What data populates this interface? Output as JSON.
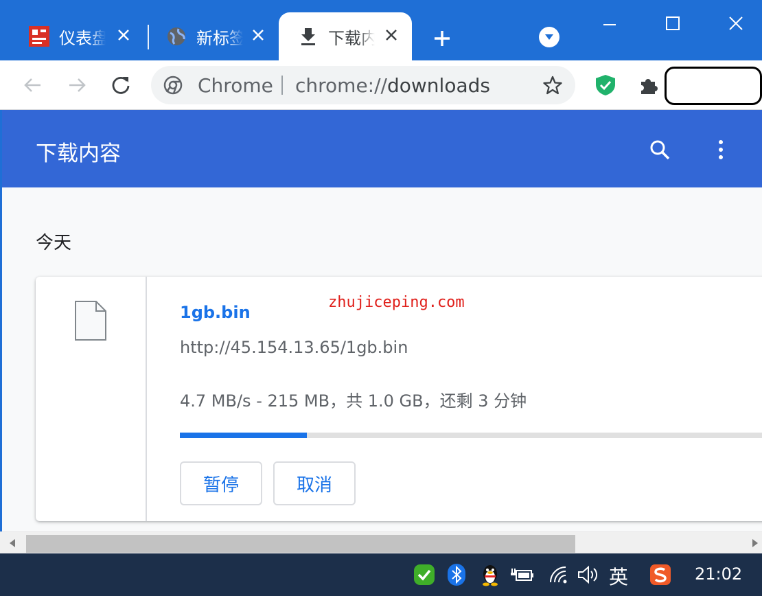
{
  "tabs": [
    {
      "title": "仪表盘",
      "favicon": "dashboard-favicon",
      "active": false
    },
    {
      "title": "新标签页",
      "favicon": "globe-icon",
      "active": false
    },
    {
      "title": "下载内容",
      "favicon": "download-icon",
      "active": true
    }
  ],
  "omnibox": {
    "site_label": "Chrome",
    "url_scheme": "chrome://",
    "url_path": "downloads"
  },
  "page": {
    "title": "下载内容",
    "date_header": "今天"
  },
  "download": {
    "file_name": "1gb.bin",
    "url": "http://45.154.13.65/1gb.bin",
    "status": "4.7 MB/s - 215 MB，共 1.0 GB，还剩 3 分钟",
    "progress_fraction": 0.215,
    "pause_label": "暂停",
    "cancel_label": "取消"
  },
  "watermark": "zhujiceping.com",
  "taskbar": {
    "ime_label": "英",
    "clock": "21:02"
  },
  "colors": {
    "tabstrip": "#1f6fd6",
    "header": "#3367d6",
    "accent": "#1a73e8",
    "watermark": "#e0201b"
  }
}
